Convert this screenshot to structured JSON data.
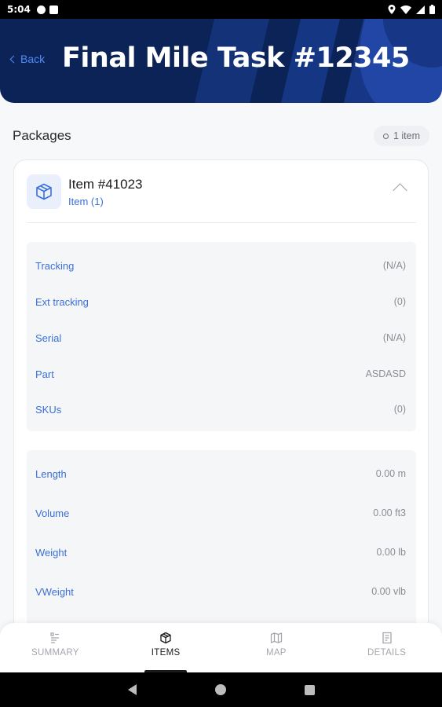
{
  "status_bar": {
    "time": "5:04"
  },
  "header": {
    "back_label": "Back",
    "title": "Final Mile Task #12345"
  },
  "packages": {
    "title": "Packages",
    "count_label": "1 item",
    "item": {
      "title": "Item #41023",
      "subtitle": "Item (1)",
      "identifiers": [
        {
          "label": "Tracking",
          "value": "(N/A)"
        },
        {
          "label": "Ext tracking",
          "value": "(0)"
        },
        {
          "label": "Serial",
          "value": "(N/A)"
        },
        {
          "label": "Part",
          "value": "ASDASD"
        },
        {
          "label": "SKUs",
          "value": "(0)"
        }
      ],
      "dimensions": [
        {
          "label": "Length",
          "value": "0.00 m"
        },
        {
          "label": "Volume",
          "value": "0.00 ft3"
        },
        {
          "label": "Weight",
          "value": "0.00 lb"
        },
        {
          "label": "VWeight",
          "value": "0.00 vlb"
        }
      ]
    }
  },
  "bottom_nav": {
    "items": [
      {
        "label": "SUMMARY",
        "icon": "summary-icon",
        "active": false
      },
      {
        "label": "ITEMS",
        "icon": "box-icon",
        "active": true
      },
      {
        "label": "MAP",
        "icon": "map-icon",
        "active": false
      },
      {
        "label": "DETAILS",
        "icon": "details-icon",
        "active": false
      }
    ]
  },
  "colors": {
    "header_bg": "#0c2357",
    "accent": "#3a6fd8",
    "link": "#4f8cf6"
  }
}
